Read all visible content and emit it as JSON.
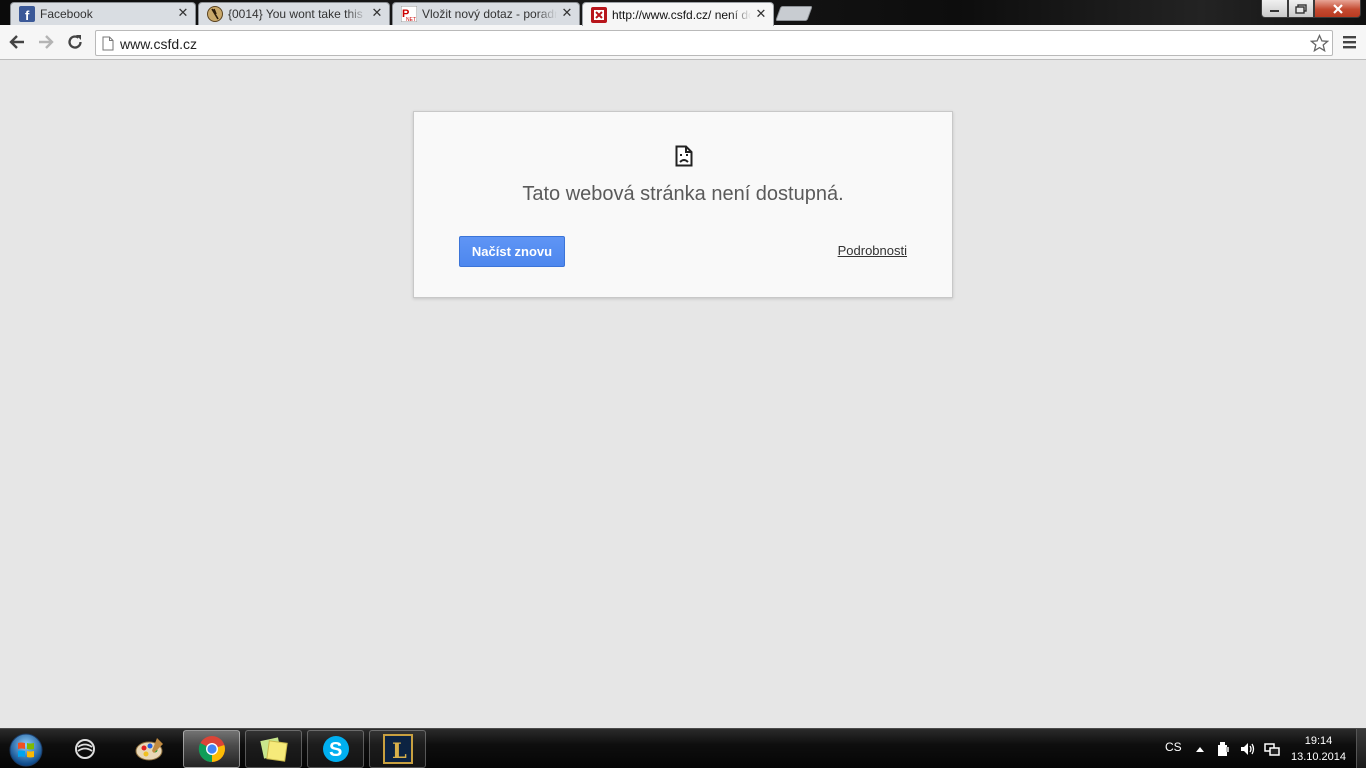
{
  "browser": {
    "tabs": [
      {
        "title": "Facebook",
        "favicon": "facebook-icon",
        "active": false
      },
      {
        "title": "{0014} You wont take this",
        "favicon": "site-icon",
        "active": false
      },
      {
        "title": "Vložit nový dotaz - poradna",
        "favicon": "poradna-icon",
        "active": false
      },
      {
        "title": "http://www.csfd.cz/ není dostupná",
        "favicon": "csfd-icon",
        "active": true
      }
    ],
    "address": "www.csfd.cz"
  },
  "error_page": {
    "title": "Tato webová stránka není dostupná.",
    "reload_label": "Načíst znovu",
    "details_label": "Podrobnosti"
  },
  "taskbar": {
    "language": "CS",
    "time": "19:14",
    "date": "13.10.2014",
    "pinned": [
      "start-orb",
      "network-app",
      "paint",
      "chrome",
      "sticky-notes",
      "skype",
      "league-of-legends"
    ]
  },
  "colors": {
    "page_background": "#e6e6e6",
    "reload_button": "#4d87ee",
    "error_text": "#5a5a5a"
  }
}
